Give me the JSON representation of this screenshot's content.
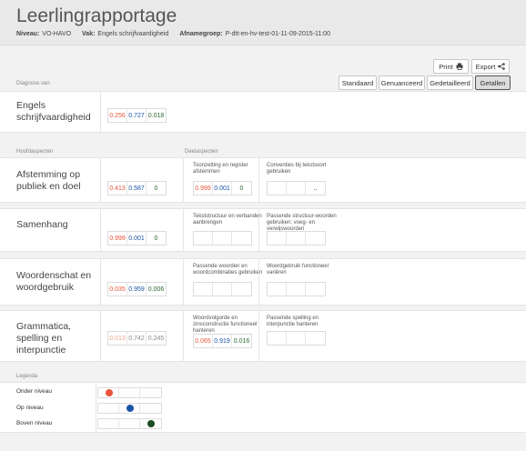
{
  "title": "Leerlingrapportage",
  "meta": {
    "niveau_label": "Niveau:",
    "niveau_value": "VO-HAVO",
    "vak_label": "Vak:",
    "vak_value": "Engels schrijfvaardigheid",
    "afname_label": "Afnamegroep:",
    "afname_value": "P-dtt-en-hv-test-01-11-09-2015-11:00"
  },
  "actions": {
    "print": "Print",
    "export": "Export"
  },
  "view_tabs": [
    "Standaard",
    "Genuanceerd",
    "Gedetailleerd",
    "Getallen"
  ],
  "labels": {
    "diagnose": "Diagnose van",
    "hoofdaspecten": "Hoofdaspecten",
    "deelaspecten": "Deelaspecten",
    "legenda": "Legenda"
  },
  "diagnose": {
    "title": "Engels schrijfvaardigheid",
    "values": [
      "0.256",
      "0.727",
      "0.018"
    ]
  },
  "rows": [
    {
      "title": "Afstemming op publiek en doel",
      "values": [
        "0.413",
        "0.587",
        "0"
      ],
      "sub": [
        {
          "caption": "Toonzetting en register afstemmen",
          "values": [
            "0.999",
            "0.001",
            "0"
          ]
        },
        {
          "caption": "Conventies bij tekstsoort gebruiken",
          "values": [
            "",
            "",
            ".."
          ]
        }
      ]
    },
    {
      "title": "Samenhang",
      "values": [
        "0.999",
        "0.001",
        "0"
      ],
      "sub": [
        {
          "caption": "Tekststructuur en verbanden aanbrengen",
          "values": [
            "",
            "",
            ""
          ]
        },
        {
          "caption": "Passende structuur-woorden gebruiken; voeg- en verwijswoorden",
          "values": [
            "",
            "",
            ""
          ]
        }
      ]
    },
    {
      "title": "Woordenschat en woordgebruik",
      "values": [
        "0.035",
        "0.959",
        "0.006"
      ],
      "sub": [
        {
          "caption": "Passende woorden en woordcombinaties gebruiken",
          "values": [
            "",
            "",
            ""
          ]
        },
        {
          "caption": "Woordgebruik functioneel variëren",
          "values": [
            "",
            "",
            ""
          ]
        }
      ]
    },
    {
      "title": "Grammatica, spelling en interpunctie",
      "values": [
        "0.013",
        "0.742",
        "0.245"
      ],
      "sub": [
        {
          "caption": "Woordvolgorde en zinsconstructie functioneel hanteren",
          "values": [
            "0.065",
            "0.919",
            "0.016"
          ]
        },
        {
          "caption": "Passende spelling en interpunctie hanteren",
          "values": [
            "",
            "",
            ""
          ]
        }
      ]
    }
  ],
  "legend": [
    {
      "label": "Onder niveau",
      "color": "#e8553a"
    },
    {
      "label": "Op niveau",
      "color": "#1a55a5"
    },
    {
      "label": "Boven niveau",
      "color": "#1d4d22"
    }
  ]
}
